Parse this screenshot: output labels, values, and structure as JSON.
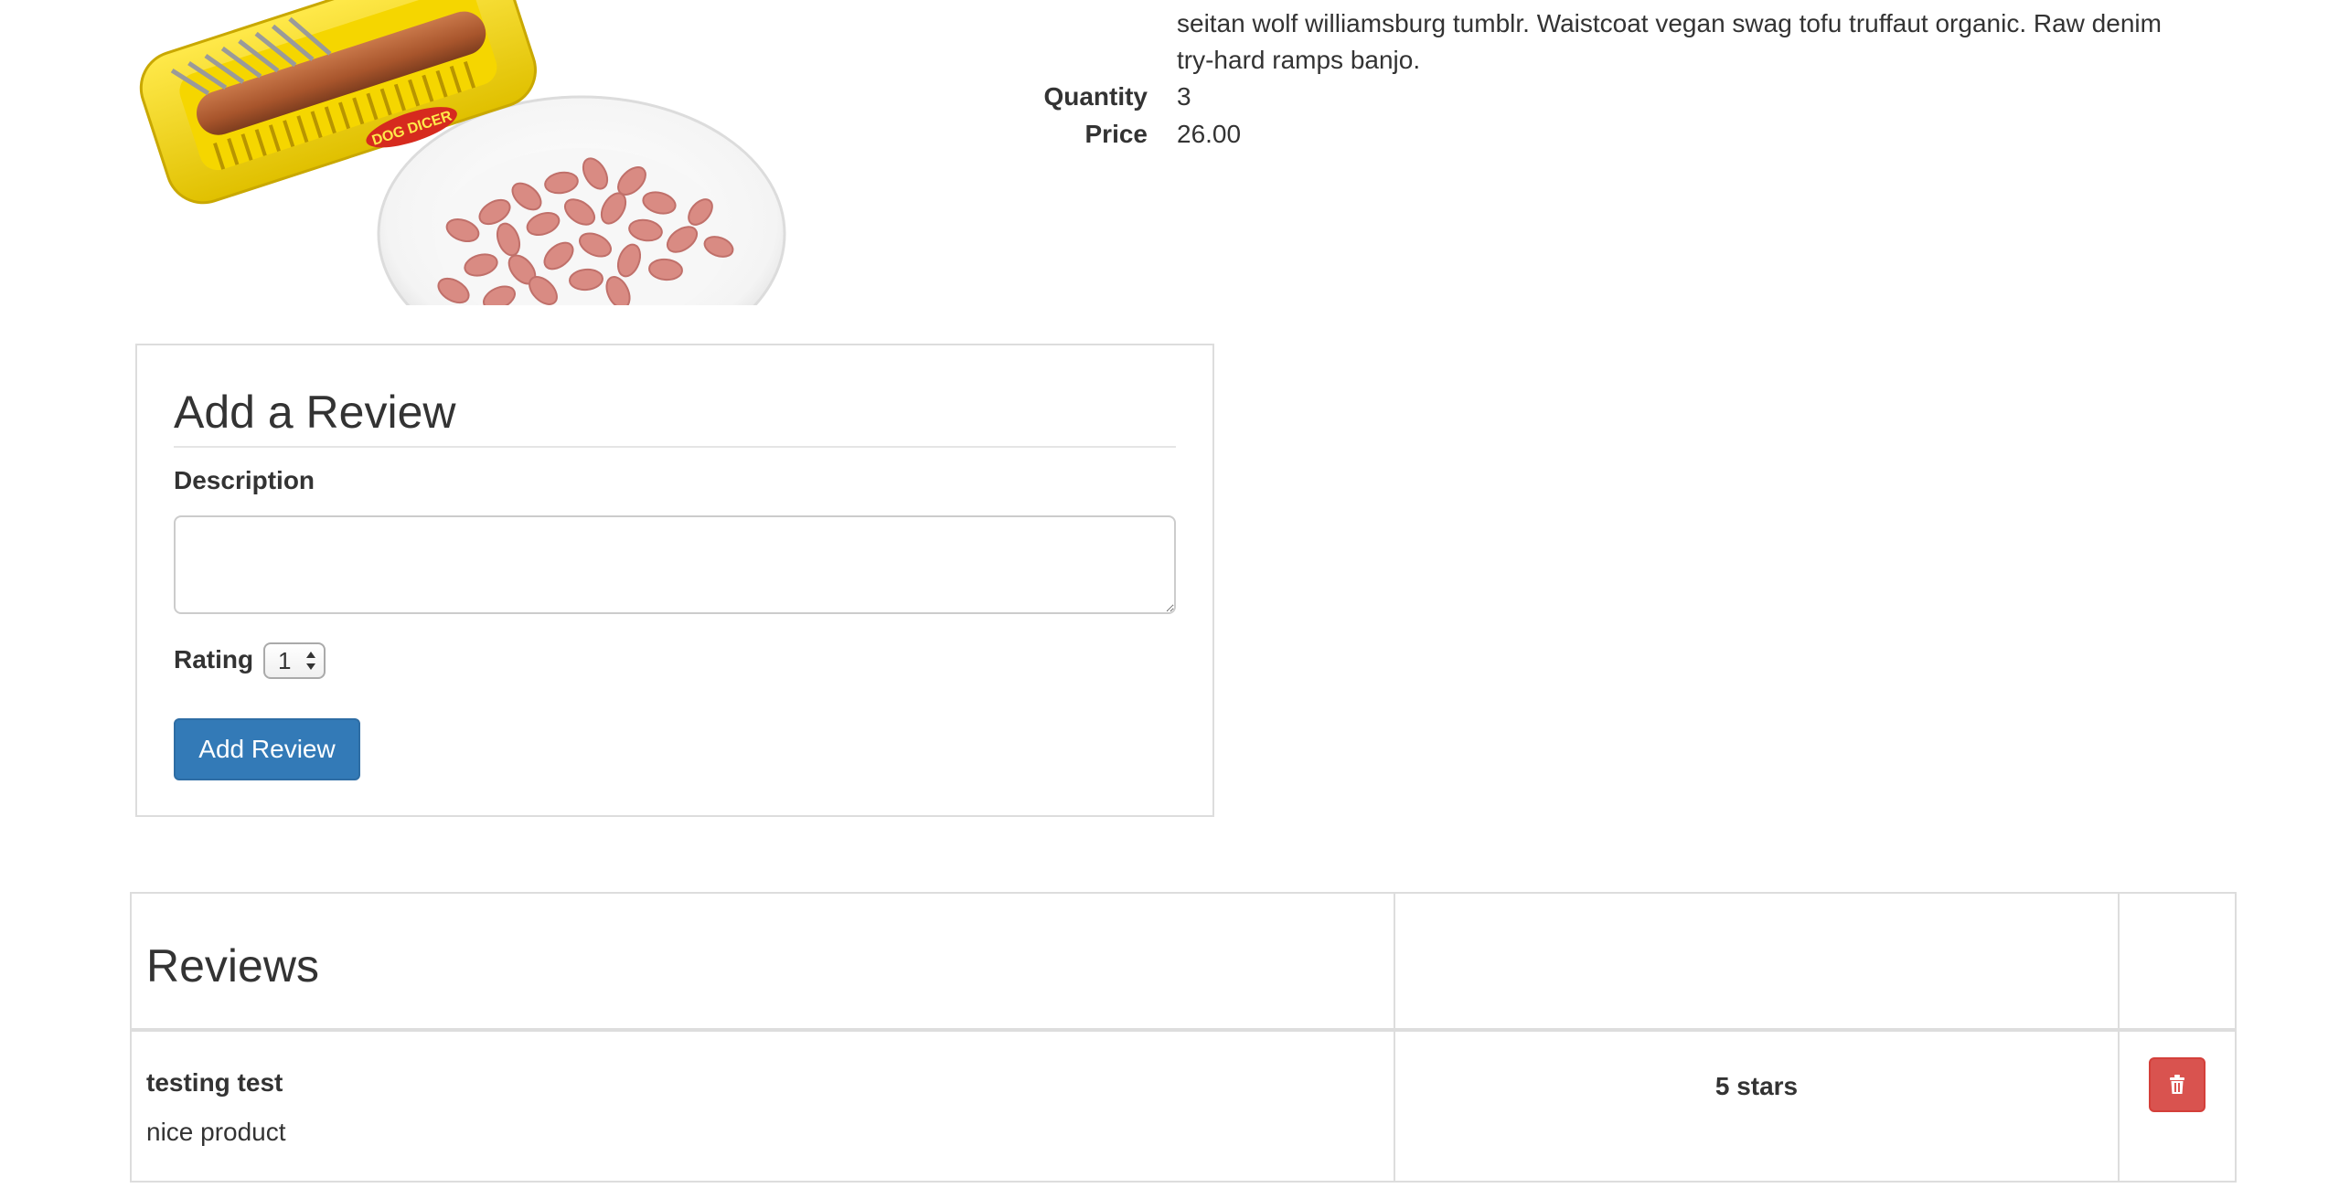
{
  "product": {
    "image_icon": "hot-dog-dicer-product-photo",
    "image_text": "DOG DICER",
    "description_lines": [
      "seitan wolf williamsburg tumblr. Waistcoat vegan swag tofu truffaut organic. Raw denim",
      "try-hard ramps banjo."
    ],
    "quantity_label": "Quantity",
    "quantity": "3",
    "price_label": "Price",
    "price": "26.00"
  },
  "review_form": {
    "title": "Add a Review",
    "description_label": "Description",
    "description_value": "",
    "rating_label": "Rating",
    "rating_value": "1",
    "submit_label": "Add Review"
  },
  "reviews": {
    "heading": "Reviews",
    "items": [
      {
        "author": "testing test",
        "text": "nice product",
        "rating": "5 stars",
        "delete_icon": "trash-icon"
      }
    ]
  },
  "colors": {
    "primary": "#337ab7",
    "danger": "#d9534f",
    "border": "#dddddd",
    "text": "#333333"
  }
}
